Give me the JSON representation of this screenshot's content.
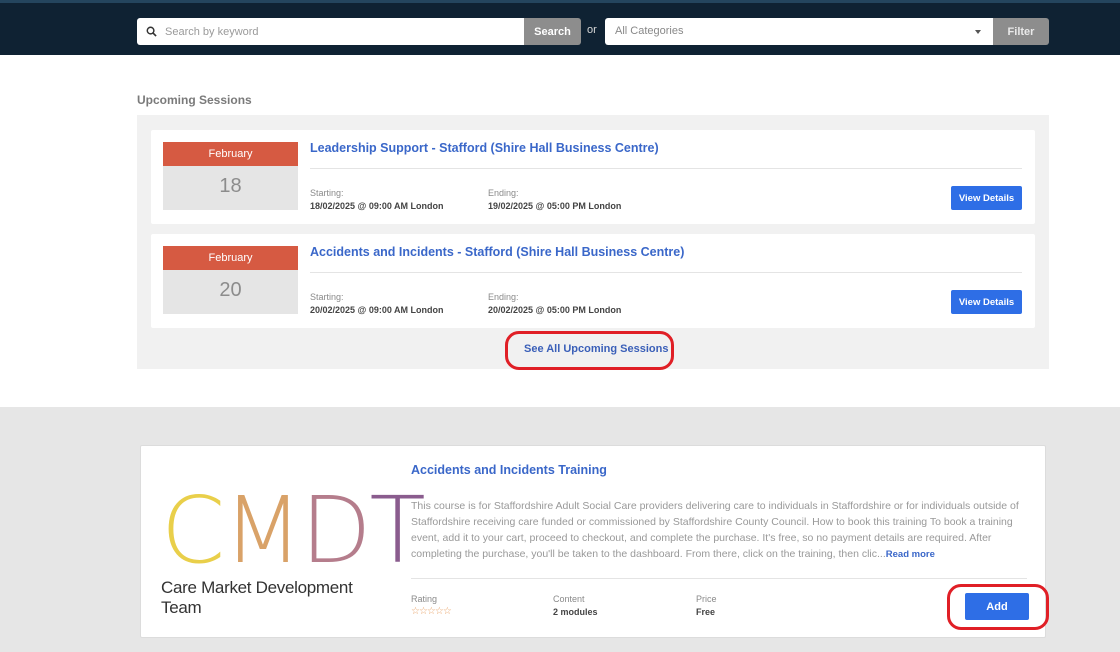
{
  "search": {
    "placeholder": "Search by keyword",
    "button_label": "Search",
    "or_text": "or",
    "category_selected": "All Categories",
    "filter_label": "Filter"
  },
  "upcoming": {
    "title": "Upcoming Sessions",
    "see_all_label": "See All Upcoming Sessions",
    "sessions": [
      {
        "month": "February",
        "day": "18",
        "title": "Leadership Support - Stafford (Shire Hall Business Centre)",
        "starting_label": "Starting:",
        "starting_value": "18/02/2025 @ 09:00 AM London",
        "ending_label": "Ending:",
        "ending_value": "19/02/2025 @ 05:00 PM London",
        "button_label": "View Details"
      },
      {
        "month": "February",
        "day": "20",
        "title": "Accidents and Incidents - Stafford (Shire Hall Business Centre)",
        "starting_label": "Starting:",
        "starting_value": "20/02/2025 @ 09:00 AM London",
        "ending_label": "Ending:",
        "ending_value": "20/02/2025 @ 05:00 PM London",
        "button_label": "View Details"
      }
    ]
  },
  "course": {
    "logo_letters": [
      "C",
      "M",
      "D",
      "T"
    ],
    "logo_colors": [
      "#e9cf4a",
      "#d9a268",
      "#b57d8c",
      "#8a5c8e"
    ],
    "logo_subtitle": "Care Market Development Team",
    "title": "Accidents and Incidents Training",
    "description": "This course is for Staffordshire Adult Social Care providers delivering care to individuals in Staffordshire or for individuals outside of Staffordshire receiving care funded or commissioned by Staffordshire County Council. How to book this training To book a training event, add it to your cart, proceed to checkout, and complete the purchase. It's free, so no payment details are required. After completing the purchase, you'll be taken to the dashboard. From there, click on the training, then clic...",
    "read_more": "Read more",
    "rating_label": "Rating",
    "rating_stars": "☆☆☆☆☆",
    "content_label": "Content",
    "content_value": "2 modules",
    "price_label": "Price",
    "price_value": "Free",
    "add_label": "Add"
  },
  "colors": {
    "topbar": "#0f2233",
    "date_month": "#d65a42",
    "link_blue": "#3a67c9",
    "button_blue": "#2e6ee6",
    "highlight_ring": "#e01f26"
  }
}
